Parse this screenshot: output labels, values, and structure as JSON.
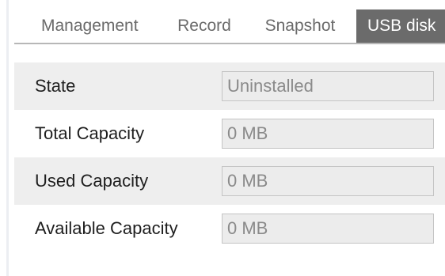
{
  "tabs": [
    {
      "label": "Management",
      "active": false
    },
    {
      "label": "Record",
      "active": false
    },
    {
      "label": "Snapshot",
      "active": false
    },
    {
      "label": "USB disk",
      "active": true
    }
  ],
  "usb_info": {
    "rows": [
      {
        "label": "State",
        "value": "Uninstalled"
      },
      {
        "label": "Total Capacity",
        "value": "0 MB"
      },
      {
        "label": "Used Capacity",
        "value": "0 MB"
      },
      {
        "label": "Available Capacity",
        "value": "0 MB"
      }
    ]
  },
  "colors": {
    "active_tab_bg": "#6b6b6b",
    "row_shade": "#eeeeee",
    "field_bg": "#ececec",
    "field_border": "#c4c4c4"
  }
}
